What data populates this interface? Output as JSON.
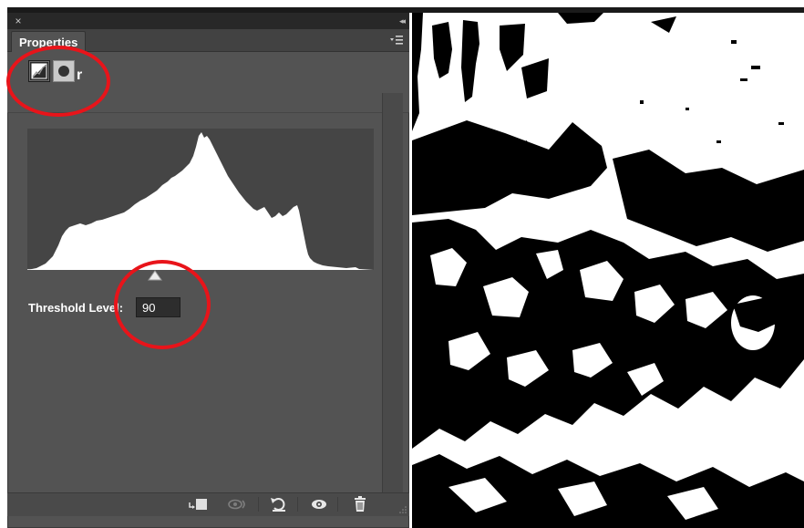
{
  "panel": {
    "close_glyph": "×",
    "collapse_glyph": "◂◂",
    "tab_label": "Properties",
    "menu_icon": "panel-menu-icon",
    "title_visible": "r",
    "adjustment_icon": "threshold-adjustment-icon",
    "mask_icon": "layer-mask-icon"
  },
  "histogram": {
    "background": "#454545",
    "fill": "#ffffff"
  },
  "threshold": {
    "label": "Threshold Level:",
    "value": "90",
    "slider_value": 90,
    "slider_range": [
      1,
      255
    ]
  },
  "bottom_bar": {
    "icons": [
      "clip-to-layer-icon",
      "view-previous-state-icon",
      "reset-icon",
      "visibility-eye-icon",
      "trash-icon"
    ]
  },
  "annotations": {
    "color": "#e8141a"
  },
  "photo": {
    "description_icon": "threshold-photo-graffiti"
  }
}
